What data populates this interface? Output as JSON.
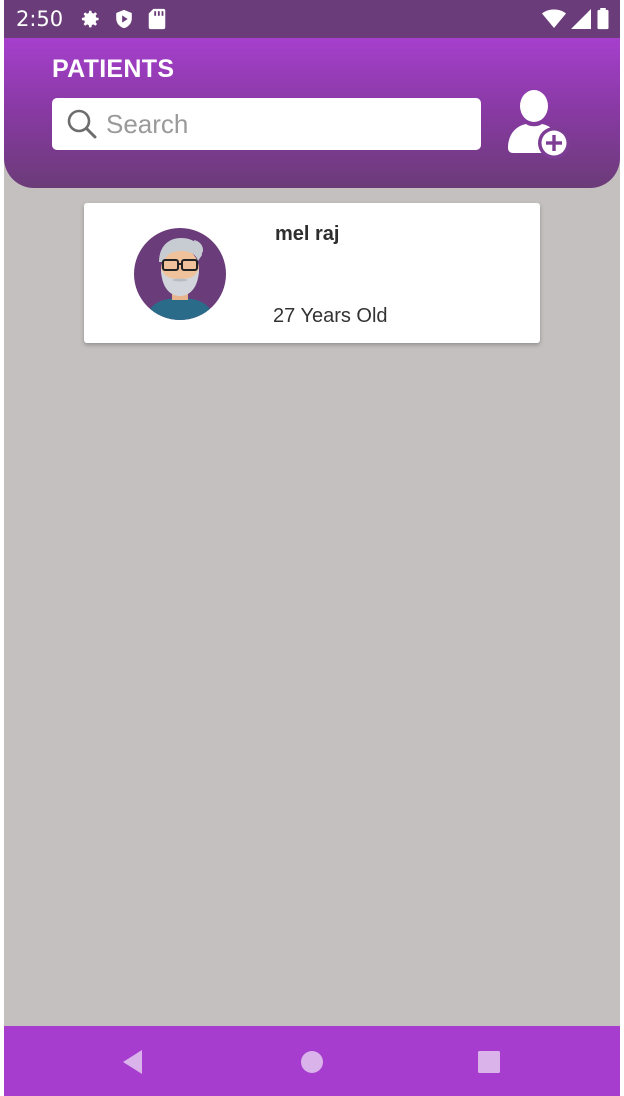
{
  "status_bar": {
    "time": "2:50",
    "icons": [
      "settings-gear-icon",
      "shield-play-icon",
      "sd-card-icon",
      "wifi-icon",
      "cell-signal-icon",
      "battery-icon"
    ]
  },
  "header": {
    "title": "PATIENTS",
    "search_placeholder": "Search",
    "search_value": "",
    "add_button_icon": "add-user-icon"
  },
  "patients": [
    {
      "name": "mel raj",
      "age_text": "27 Years Old",
      "avatar_icon": "old-man-avatar-icon"
    }
  ],
  "nav_bar": {
    "buttons": [
      "back-triangle-icon",
      "home-circle-icon",
      "recents-square-icon"
    ]
  },
  "colors": {
    "status_bar": "#6a3d7a",
    "header_top": "#a63fcd",
    "header_bottom": "#6b3b78",
    "background": "#c4c0bf",
    "nav_bar": "#a63dce",
    "avatar_bg": "#6a3d7a"
  }
}
